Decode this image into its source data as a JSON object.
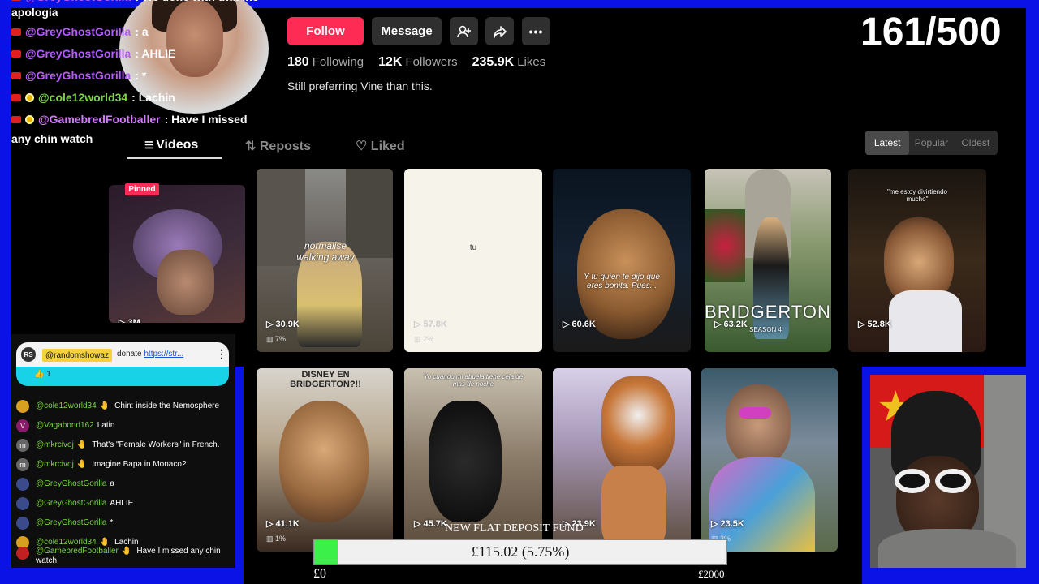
{
  "profile": {
    "follow_label": "Follow",
    "message_label": "Message",
    "following_count": "180",
    "following_label": "Following",
    "followers_count": "12K",
    "followers_label": "Followers",
    "likes_count": "235.9K",
    "likes_label": "Likes",
    "bio": "Still preferring Vine than this."
  },
  "tabs": [
    {
      "label": "Videos",
      "icon": "grid-icon",
      "active": true
    },
    {
      "label": "Reposts",
      "icon": "repost-icon"
    },
    {
      "label": "Liked",
      "icon": "heart-outline-icon"
    }
  ],
  "sort": {
    "latest": "Latest",
    "popular": "Popular",
    "oldest": "Oldest"
  },
  "videos": [
    {
      "views": "3M",
      "badge": "Pinned"
    },
    {
      "views": "30.9K",
      "pct": "7%",
      "caption": "normalise walking away"
    },
    {
      "views": "57.8K",
      "pct": "2%",
      "caption": "tu"
    },
    {
      "views": "60.6K",
      "caption": "Y tu quien te dijo que eres bonita. Pues..."
    },
    {
      "views": "63.2K",
      "caption": "BRIDGERTON",
      "subcaption": "SEASON 4"
    },
    {
      "views": "52.8K",
      "caption": "\"me estoy divirtiendo mucho\""
    },
    {
      "views": "41.1K",
      "pct": "1%",
      "caption": "DISNEY EN BRIDGERTON?!!"
    },
    {
      "views": "45.7K",
      "caption": "Yo cuando mi abuela tiene ceja de mas de noche"
    },
    {
      "views": "23.9K"
    },
    {
      "views": "23.5K",
      "pct": "3%"
    }
  ],
  "overlay_chat": [
    {
      "user": "@GreyGhostGorilla",
      "text": ": We done with that ine"
    },
    {
      "user": "",
      "text": "apologia"
    },
    {
      "user": "@GreyGhostGorilla",
      "text": ": a"
    },
    {
      "user": "@GreyGhostGorilla",
      "text": ": AHLIE"
    },
    {
      "user": "@GreyGhostGorilla",
      "text": ": *"
    },
    {
      "user": "@cole12world34",
      "text": ": Lachin"
    },
    {
      "user": "@GamebredFootballer",
      "text": ": Have I missed"
    },
    {
      "user": "",
      "text": "any chin watch"
    }
  ],
  "counter": "161/500",
  "donation": {
    "avatar_initials": "RS",
    "user": "@randomshowaz",
    "text": "donate",
    "link": "https://str...",
    "likes": "1"
  },
  "chat_panel": [
    {
      "user": "@cole12world34",
      "text": "Chin: inside the Nemosphere",
      "avatar": "",
      "color": "#d8a020"
    },
    {
      "user": "@Vagabond162",
      "text": "Latin",
      "avatar": "V",
      "color": "#8a1a6a"
    },
    {
      "user": "@mkrcivoj",
      "text": "That's \"Female Workers\" in French.",
      "avatar": "m",
      "color": "#666"
    },
    {
      "user": "@mkrcivoj",
      "text": "Imagine Bapa in Monaco?",
      "avatar": "m",
      "color": "#666"
    },
    {
      "user": "@GreyGhostGorilla",
      "text": "a",
      "avatar": "",
      "color": "#3a4a8a"
    },
    {
      "user": "@GreyGhostGorilla",
      "text": "AHLIE",
      "avatar": "",
      "color": "#3a4a8a"
    },
    {
      "user": "@GreyGhostGorilla",
      "text": "*",
      "avatar": "",
      "color": "#3a4a8a"
    },
    {
      "user": "@cole12world34",
      "text": "Lachin",
      "avatar": "",
      "color": "#d8a020"
    },
    {
      "user": "@GamebredFootballer",
      "text": "Have I missed any chin watch",
      "avatar": "",
      "color": "#c02020"
    }
  ],
  "fund": {
    "title": "NEW FLAT DEPOSIT FUND",
    "amount": "£115.02 (5.75%)",
    "fraction": 0.0575,
    "min": "£0",
    "max": "£2000"
  },
  "colors": {
    "stream_background": "#0a12e6",
    "follow": "#fe2c55",
    "fund_fill": "#3cf04a"
  }
}
